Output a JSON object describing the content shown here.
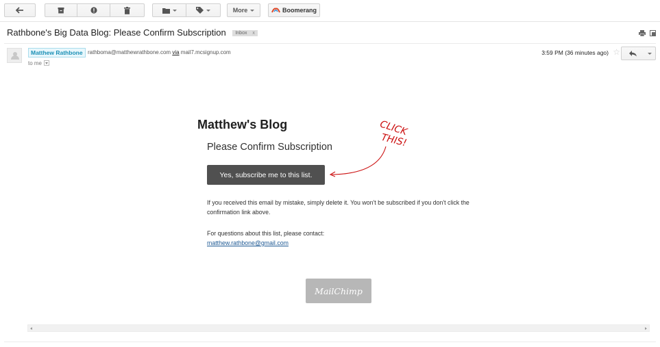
{
  "toolbar": {
    "back": "back-arrow-icon",
    "archive": "archive-icon",
    "spam": "report-spam-icon",
    "delete": "trash-icon",
    "move": "folder-icon",
    "labels": "label-tag-icon",
    "more_label": "More",
    "boomerang_label": "Boomerang"
  },
  "email": {
    "subject": "Rathbone's Big Data Blog: Please Confirm Subscription",
    "label": "Inbox",
    "label_close": "x",
    "sender_name": "Matthew Rathbone",
    "sender_email": "rathboma@matthewrathbone.com",
    "via_word": "via",
    "via_domain": "mail7.mcsignup.com",
    "recipient": "to me",
    "timestamp": "3:59 PM (36 minutes ago)"
  },
  "body": {
    "blog_title": "Matthew's Blog",
    "heading": "Please Confirm Subscription",
    "button_label": "Yes, subscribe me to this list.",
    "paragraph1": "If you received this email by mistake, simply delete it. You won't be subscribed if you don't click the confirmation link above.",
    "paragraph2": "For questions about this list, please contact:",
    "contact_email": "matthew.rathbone@gmail.com",
    "annotation_line1": "CLICK",
    "annotation_line2": "THIS!",
    "footer_logo_text": "MailChimp"
  },
  "colors": {
    "accent": "#1a8fb5",
    "button_bg": "#505050",
    "annotation": "#cc1111",
    "link": "#1f5a94"
  }
}
